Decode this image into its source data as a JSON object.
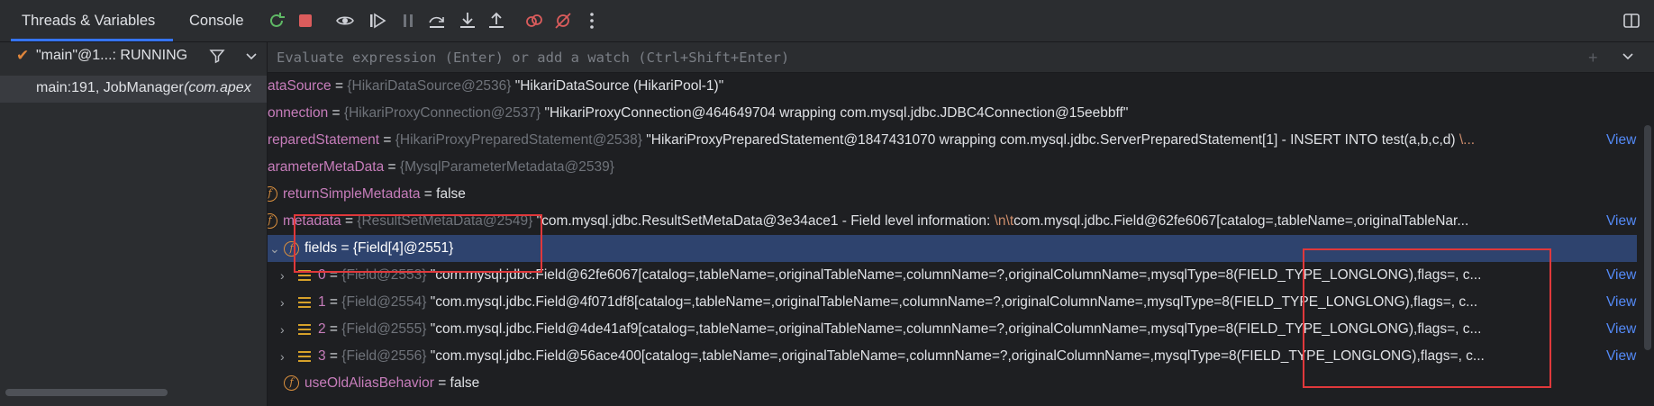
{
  "tabs": {
    "threads_vars": "Threads & Variables",
    "console": "Console"
  },
  "colors": {
    "accent": "#3574f0",
    "selection": "#2e436e",
    "link": "#548af7",
    "annotation": "#e0383b"
  },
  "threads": {
    "selected_thread": "\"main\"@1...: RUNNING",
    "frame": "main:191, JobManager ",
    "frame_class": "(com.apex"
  },
  "eval": {
    "placeholder": "Evaluate expression (Enter) or add a watch (Ctrl+Shift+Enter)"
  },
  "variables": [
    {
      "name": "ataSource",
      "type": "{HikariDataSource@2536}",
      "value": "\"HikariDataSource (HikariPool-1)\""
    },
    {
      "name": "onnection",
      "type": "{HikariProxyConnection@2537}",
      "value": "\"HikariProxyConnection@464649704 wrapping com.mysql.jdbc.JDBC4Connection@15eebbff\""
    },
    {
      "name": "reparedStatement",
      "type": "{HikariProxyPreparedStatement@2538}",
      "value": "\"HikariProxyPreparedStatement@1847431070 wrapping com.mysql.jdbc.ServerPreparedStatement[1] - INSERT INTO test(a,b,c,d) ",
      "esc": "\\...",
      "link": "View"
    },
    {
      "name": "arameterMetaData",
      "type": "{MysqlParameterMetadata@2539}",
      "value": ""
    },
    {
      "name": "returnSimpleMetadata",
      "eq": " = false"
    },
    {
      "name": "metadata",
      "type": "{ResultSetMetaData@2549}",
      "value": "\"com.mysql.jdbc.ResultSetMetaData@3e34ace1 - Field level information: ",
      "esc": "\\n\\t",
      "value2": "com.mysql.jdbc.Field@62fe6067[catalog=,tableName=,originalTableNar...",
      "link": "View"
    },
    {
      "name": "fields",
      "eq": " = {Field[4]@2551}"
    },
    {
      "index": "0",
      "type": "{Field@2553}",
      "value": "\"com.mysql.jdbc.Field@62fe6067[catalog=,tableName=,originalTableName=,columnName=?,originalColumnName=,mysqlType=8(FIELD_TYPE_LONGLONG),flags=, c...",
      "link": "View"
    },
    {
      "index": "1",
      "type": "{Field@2554}",
      "value": "\"com.mysql.jdbc.Field@4f071df8[catalog=,tableName=,originalTableName=,columnName=?,originalColumnName=,mysqlType=8(FIELD_TYPE_LONGLONG),flags=, c...",
      "link": "View"
    },
    {
      "index": "2",
      "type": "{Field@2555}",
      "value": "\"com.mysql.jdbc.Field@4de41af9[catalog=,tableName=,originalTableName=,columnName=?,originalColumnName=,mysqlType=8(FIELD_TYPE_LONGLONG),flags=, c...",
      "link": "View"
    },
    {
      "index": "3",
      "type": "{Field@2556}",
      "value": "\"com.mysql.jdbc.Field@56ace400[catalog=,tableName=,originalTableName=,columnName=?,originalColumnName=,mysqlType=8(FIELD_TYPE_LONGLONG),flags=, c...",
      "link": "View"
    },
    {
      "name": "useOldAliasBehavior",
      "eq": " = false"
    }
  ]
}
